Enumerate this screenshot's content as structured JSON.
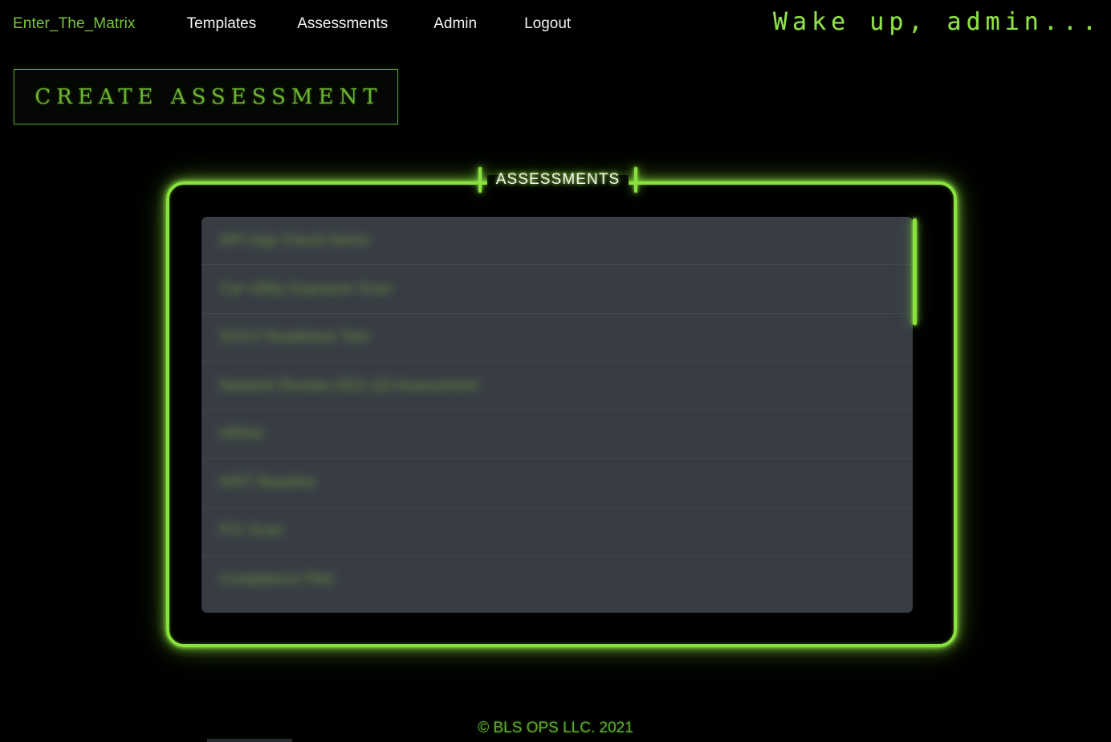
{
  "navbar": {
    "brand": "Enter_The_Matrix",
    "links": [
      {
        "label": "Templates"
      },
      {
        "label": "Assessments"
      },
      {
        "label": "Admin"
      },
      {
        "label": "Logout"
      }
    ],
    "greeting": "Wake up, admin..."
  },
  "actions": {
    "create_assessment_label": "CREATE ASSESSMENT"
  },
  "panel": {
    "legend": "ASSESSMENTS"
  },
  "list": {
    "items": [
      {
        "label": "API Gap Check Demo",
        "redacted": true
      },
      {
        "label": "Car Utility Exposure Scan",
        "redacted": true
      },
      {
        "label": "SOC2 Readiness Test",
        "redacted": true
      },
      {
        "label": "Network Review 2021 Q3 Assessment",
        "redacted": true
      },
      {
        "label": "HIPAA",
        "redacted": true
      },
      {
        "label": "NIST Baseline",
        "redacted": true
      },
      {
        "label": "PCI Scan",
        "redacted": true
      },
      {
        "label": "Compliance Pilot",
        "redacted": true
      }
    ],
    "scroll": {
      "thumb_visible": true
    }
  },
  "footer": {
    "copyright": "© BLS OPS LLC. 2021"
  },
  "colors": {
    "background": "#000000",
    "accent_green": "#8ae23f",
    "brand_green": "#7ac43c",
    "button_green": "#6cb52f",
    "footer_green": "#5fae2e",
    "list_background": "#383d44",
    "list_separator": "#42474e",
    "nav_text": "#f2f2f2",
    "legend_text": "#f4f8ee"
  }
}
